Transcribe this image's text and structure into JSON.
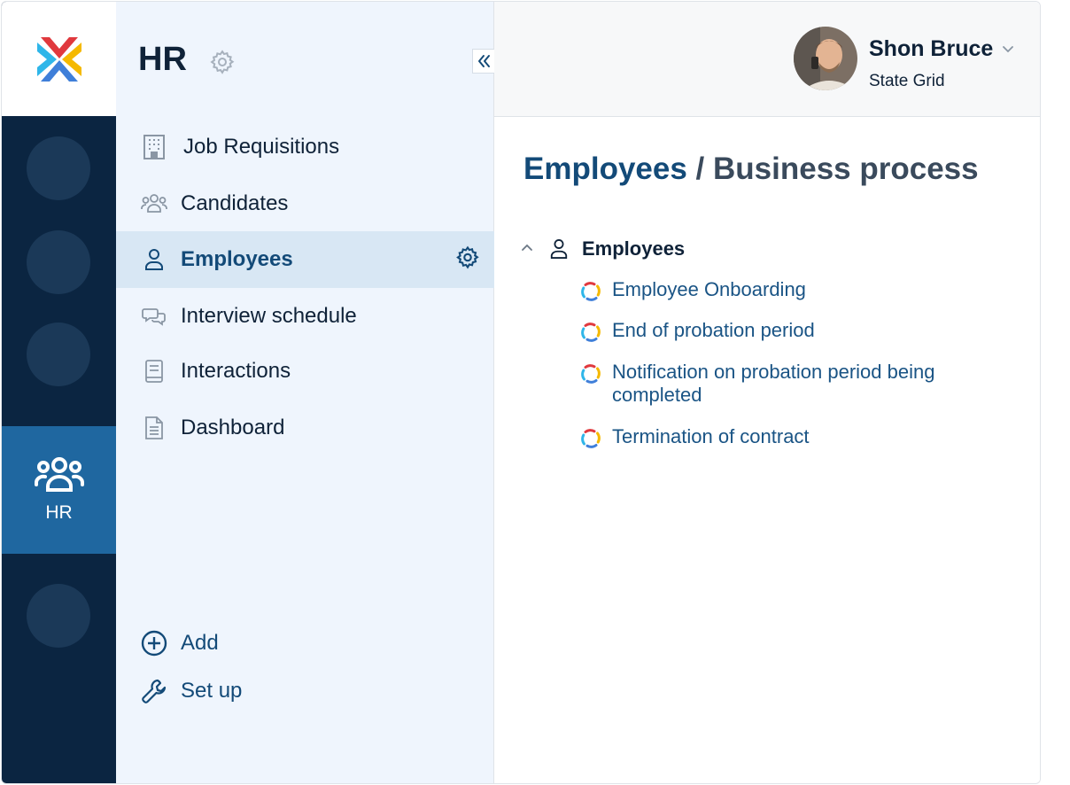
{
  "sidebar": {
    "title": "HR",
    "nav": [
      {
        "label": "Job Requisitions",
        "icon": "building-icon"
      },
      {
        "label": "Candidates",
        "icon": "people-icon"
      },
      {
        "label": "Employees",
        "icon": "person-icon",
        "active": true
      },
      {
        "label": "Interview schedule",
        "icon": "chat-bubbles-icon"
      },
      {
        "label": "Interactions",
        "icon": "book-icon"
      },
      {
        "label": "Dashboard",
        "icon": "document-icon"
      }
    ],
    "bottom": [
      {
        "label": "Add",
        "icon": "plus-circle-icon"
      },
      {
        "label": "Set up",
        "icon": "wrench-icon"
      }
    ]
  },
  "rail": {
    "active_label": "HR"
  },
  "user": {
    "name": "Shon Bruce",
    "org": "State Grid"
  },
  "breadcrumb": {
    "parent": "Employees",
    "separator": "/",
    "current": "Business process"
  },
  "tree": {
    "group_label": "Employees",
    "processes": [
      "Employee Onboarding",
      "End of probation period",
      "Notification on probation period being completed",
      "Termination of contract"
    ]
  },
  "colors": {
    "rail_bg": "#0b2541",
    "rail_active": "#1f67a0",
    "sidebar_bg": "#eff5fd",
    "active_item_bg": "#d8e7f4",
    "link": "#1a5485"
  }
}
